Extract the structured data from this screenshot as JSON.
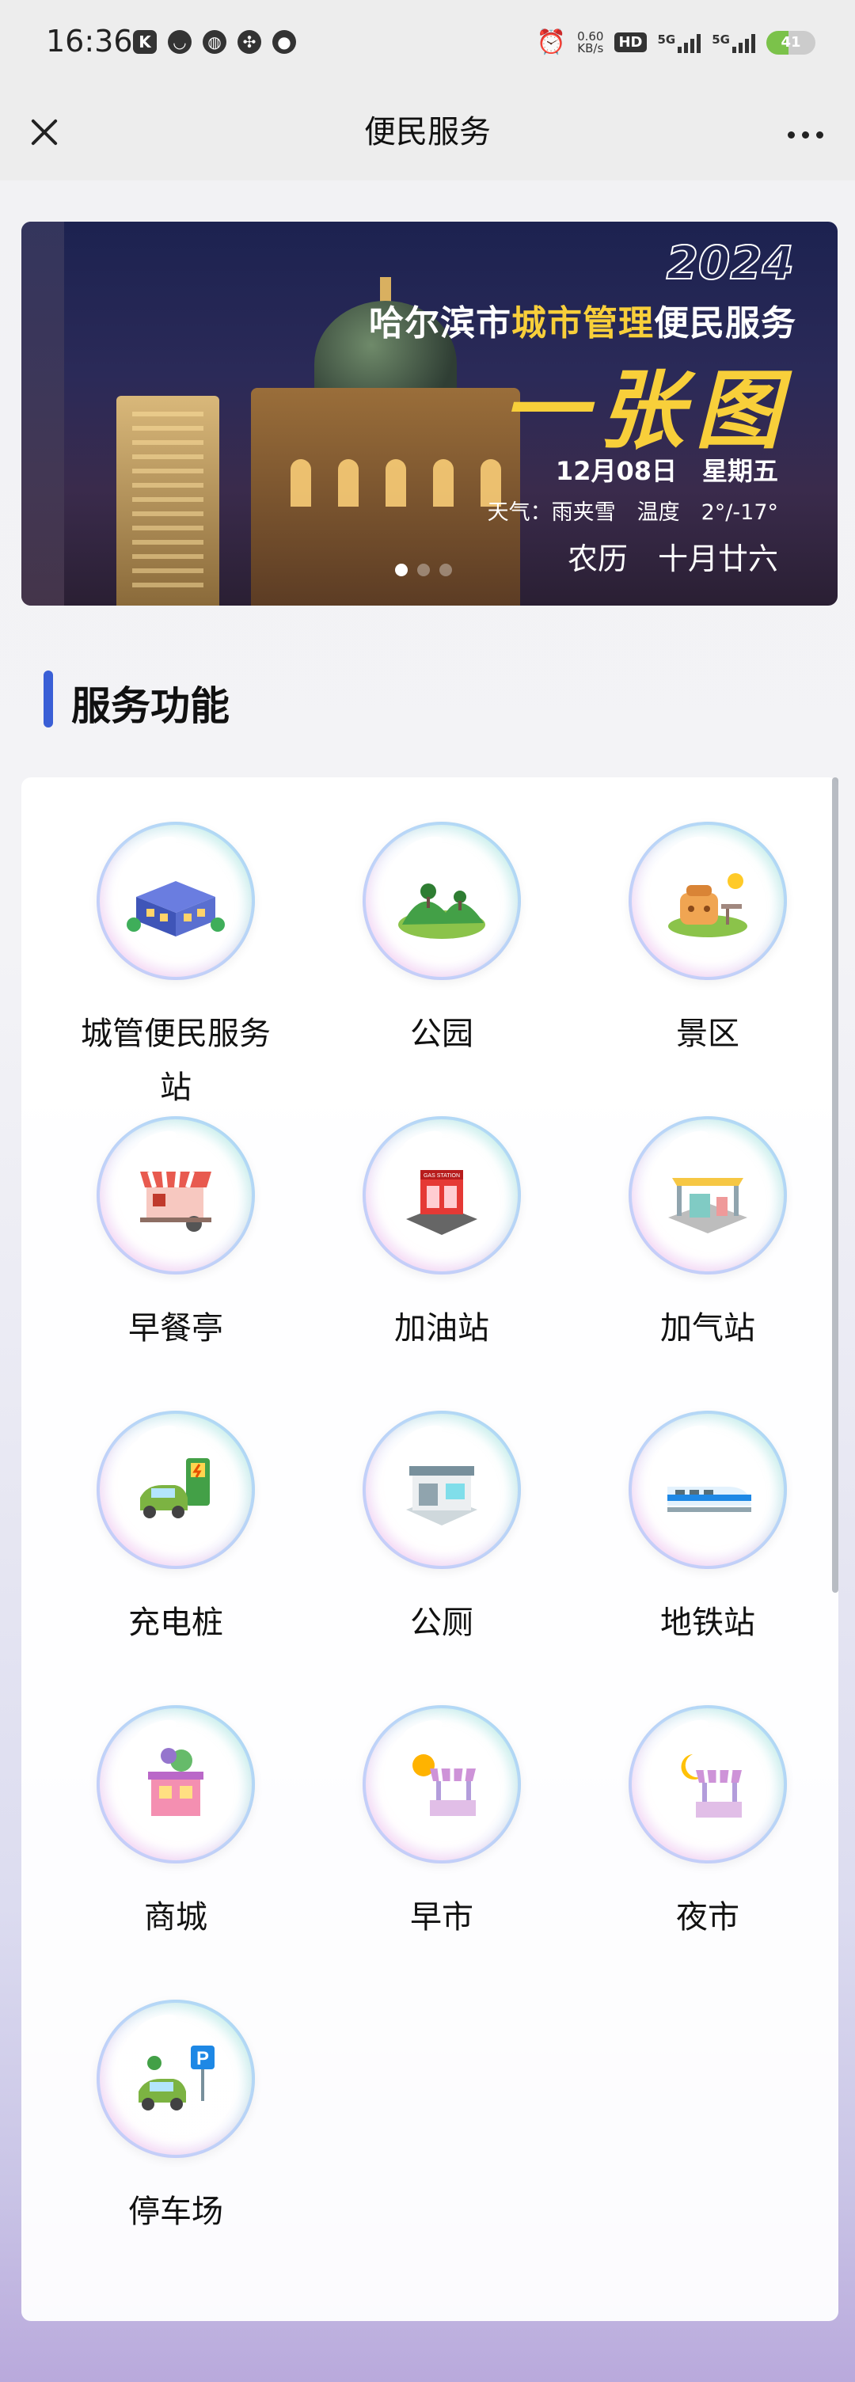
{
  "status_bar": {
    "time": "16:36",
    "net_speed_value": "0.60",
    "net_speed_unit": "KB/s",
    "hd_label": "HD",
    "signal1_label": "5G",
    "signal2_label": "5G",
    "battery": "41"
  },
  "title_bar": {
    "title": "便民服务"
  },
  "banner": {
    "year": "2024",
    "headline_part1": "哈尔滨市",
    "headline_highlight": "城市管理",
    "headline_part2": "便民服务",
    "big_text": "一张图",
    "date": "12月08日　星期五",
    "weather": "天气：雨夹雪　温度　2°/-17°",
    "lunar": "农历　十月廿六",
    "slides": 3,
    "active_slide": 1
  },
  "section": {
    "title": "服务功能"
  },
  "services": [
    {
      "label": "城管便民服务站",
      "icon": "service-station-icon"
    },
    {
      "label": "公园",
      "icon": "park-icon"
    },
    {
      "label": "景区",
      "icon": "scenic-area-icon"
    },
    {
      "label": "早餐亭",
      "icon": "breakfast-kiosk-icon"
    },
    {
      "label": "加油站",
      "icon": "gas-station-icon"
    },
    {
      "label": "加气站",
      "icon": "gas-filling-station-icon"
    },
    {
      "label": "充电桩",
      "icon": "charging-pile-icon"
    },
    {
      "label": "公厕",
      "icon": "public-toilet-icon"
    },
    {
      "label": "地铁站",
      "icon": "subway-station-icon"
    },
    {
      "label": "商城",
      "icon": "mall-icon"
    },
    {
      "label": "早市",
      "icon": "morning-market-icon"
    },
    {
      "label": "夜市",
      "icon": "night-market-icon"
    },
    {
      "label": "停车场",
      "icon": "parking-lot-icon"
    }
  ],
  "colors": {
    "accent": "#3a5fd6",
    "highlight": "#f8cf3a"
  }
}
